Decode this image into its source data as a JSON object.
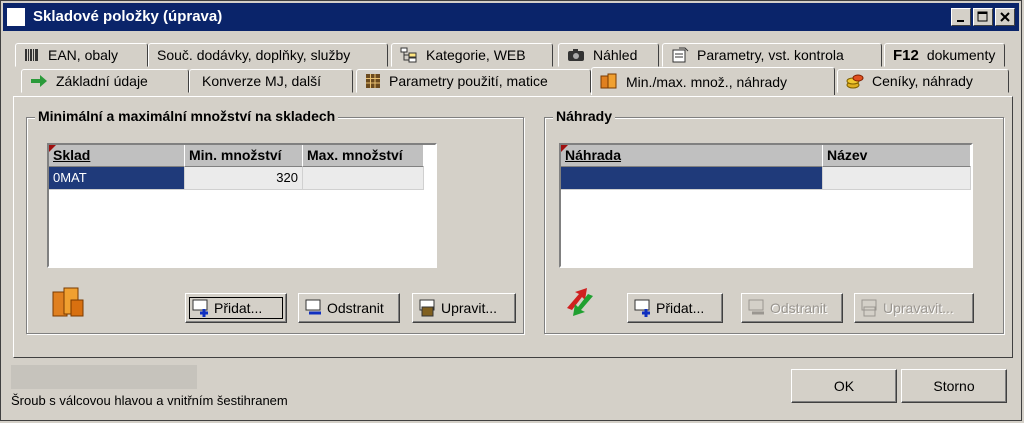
{
  "window": {
    "title": "Skladové položky (úprava)"
  },
  "tabs_row1": [
    {
      "label": "EAN, obaly",
      "icon": "barcode-icon"
    },
    {
      "label": "Souč. dodávky, doplňky, služby",
      "icon": "none"
    },
    {
      "label": "Kategorie, WEB",
      "icon": "category-tree-icon"
    },
    {
      "label": "Náhled",
      "icon": "camera-icon"
    },
    {
      "label": "Parametry, vst. kontrola",
      "icon": "parameters-icon"
    },
    {
      "label": "dokumenty",
      "icon": "f12-icon",
      "prefix": "F12"
    }
  ],
  "tabs_row2": [
    {
      "label": "Základní údaje",
      "icon": "green-arrow-icon"
    },
    {
      "label": "Konverze MJ, další",
      "icon": "none"
    },
    {
      "label": "Parametry použití, matice",
      "icon": "matrix-icon"
    },
    {
      "label": "Min./max. množ., náhrady",
      "icon": "boxes-icon",
      "active": true
    },
    {
      "label": "Ceníky, náhrady",
      "icon": "price-coins-icon"
    }
  ],
  "minmax": {
    "title": "Minimální a maximální množství na skladech",
    "columns": [
      "Sklad",
      "Min. množství",
      "Max. množství"
    ],
    "rows": [
      {
        "sklad": "0MAT",
        "min": "320",
        "max": ""
      }
    ],
    "buttons": {
      "add": "Přidat...",
      "remove": "Odstranit",
      "edit": "Upravit..."
    }
  },
  "nahrady": {
    "title": "Náhrady",
    "columns": [
      "Náhrada",
      "Název"
    ],
    "buttons": {
      "add": "Přidat...",
      "remove": "Odstranit",
      "edit": "Upravavit..."
    }
  },
  "status": {
    "text": "Šroub s válcovou hlavou a vnitřním šestihranem"
  },
  "dialog": {
    "ok": "OK",
    "cancel": "Storno"
  }
}
